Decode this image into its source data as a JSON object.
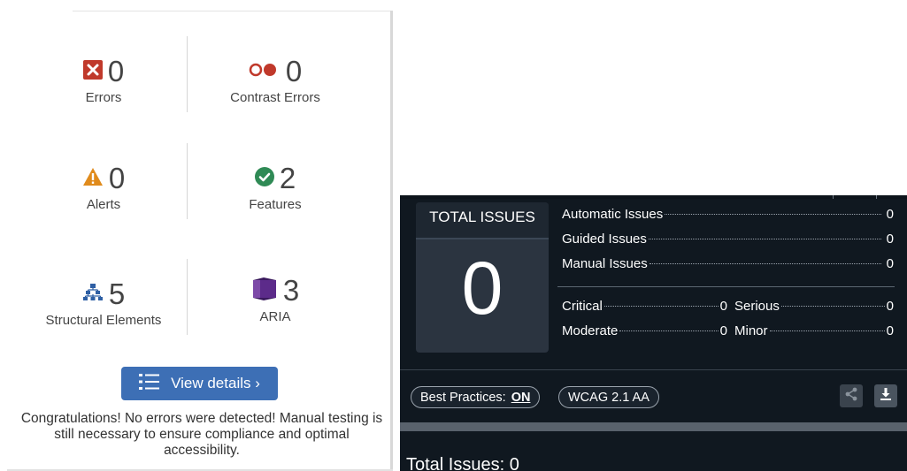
{
  "summary": {
    "errors": {
      "value": "0",
      "label": "Errors"
    },
    "contrast_errors": {
      "value": "0",
      "label": "Contrast Errors"
    },
    "alerts": {
      "value": "0",
      "label": "Alerts"
    },
    "features": {
      "value": "2",
      "label": "Features"
    },
    "structural": {
      "value": "5",
      "label": "Structural Elements"
    },
    "aria": {
      "value": "3",
      "label": "ARIA"
    },
    "view_details_label": "View details ›",
    "message": "Congratulations! No errors were detected! Manual testing is still necessary to ensure compliance and optimal accessibility.",
    "colors": {
      "error": "#c0392b",
      "alert": "#e08b1c",
      "feature": "#2f8a55",
      "structural": "#2e5fa4",
      "aria": "#5c2b8a",
      "button": "#3d6fb5"
    }
  },
  "report": {
    "total_title": "TOTAL ISSUES",
    "total_value": "0",
    "issues": [
      {
        "label": "Automatic Issues",
        "value": "0"
      },
      {
        "label": "Guided Issues",
        "value": "0"
      },
      {
        "label": "Manual Issues",
        "value": "0"
      }
    ],
    "severity": {
      "critical": {
        "label": "Critical",
        "value": "0"
      },
      "serious": {
        "label": "Serious",
        "value": "0"
      },
      "moderate": {
        "label": "Moderate",
        "value": "0"
      },
      "minor": {
        "label": "Minor",
        "value": "0"
      }
    },
    "best_practices_label": "Best Practices:",
    "best_practices_state": "ON",
    "wcag_label": "WCAG 2.1 AA",
    "footer_text": "Total Issues: 0",
    "icons": {
      "share": "share-icon",
      "download": "download-icon"
    }
  }
}
